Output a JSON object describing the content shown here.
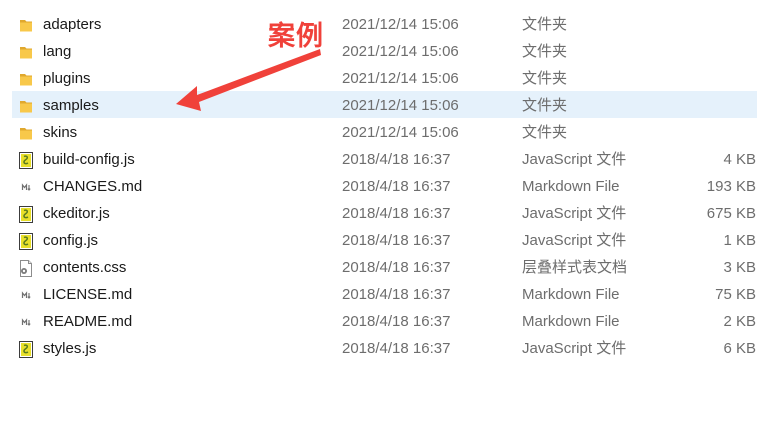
{
  "files": [
    {
      "name": "adapters",
      "date": "2021/12/14 15:06",
      "type": "文件夹",
      "size": "",
      "icon": "folder-icon",
      "selected": false
    },
    {
      "name": "lang",
      "date": "2021/12/14 15:06",
      "type": "文件夹",
      "size": "",
      "icon": "folder-icon",
      "selected": false
    },
    {
      "name": "plugins",
      "date": "2021/12/14 15:06",
      "type": "文件夹",
      "size": "",
      "icon": "folder-icon",
      "selected": false
    },
    {
      "name": "samples",
      "date": "2021/12/14 15:06",
      "type": "文件夹",
      "size": "",
      "icon": "folder-icon",
      "selected": true
    },
    {
      "name": "skins",
      "date": "2021/12/14 15:06",
      "type": "文件夹",
      "size": "",
      "icon": "folder-icon",
      "selected": false
    },
    {
      "name": "build-config.js",
      "date": "2018/4/18 16:37",
      "type": "JavaScript 文件",
      "size": "4 KB",
      "icon": "javascript-file-icon",
      "selected": false
    },
    {
      "name": "CHANGES.md",
      "date": "2018/4/18 16:37",
      "type": "Markdown File",
      "size": "193 KB",
      "icon": "markdown-file-icon",
      "selected": false
    },
    {
      "name": "ckeditor.js",
      "date": "2018/4/18 16:37",
      "type": "JavaScript 文件",
      "size": "675 KB",
      "icon": "javascript-file-icon",
      "selected": false
    },
    {
      "name": "config.js",
      "date": "2018/4/18 16:37",
      "type": "JavaScript 文件",
      "size": "1 KB",
      "icon": "javascript-file-icon",
      "selected": false
    },
    {
      "name": "contents.css",
      "date": "2018/4/18 16:37",
      "type": "层叠样式表文档",
      "size": "3 KB",
      "icon": "css-file-icon",
      "selected": false
    },
    {
      "name": "LICENSE.md",
      "date": "2018/4/18 16:37",
      "type": "Markdown File",
      "size": "75 KB",
      "icon": "markdown-file-icon",
      "selected": false
    },
    {
      "name": "README.md",
      "date": "2018/4/18 16:37",
      "type": "Markdown File",
      "size": "2 KB",
      "icon": "markdown-file-icon",
      "selected": false
    },
    {
      "name": "styles.js",
      "date": "2018/4/18 16:37",
      "type": "JavaScript 文件",
      "size": "6 KB",
      "icon": "javascript-file-icon",
      "selected": false
    }
  ],
  "annotation": {
    "label": "案例",
    "color": "#f0413a"
  },
  "colors": {
    "selection": "#e5f1fb",
    "folder": "#f8c84a",
    "folder_dark": "#e0a82e",
    "secondary_text": "#6d6d6d"
  }
}
